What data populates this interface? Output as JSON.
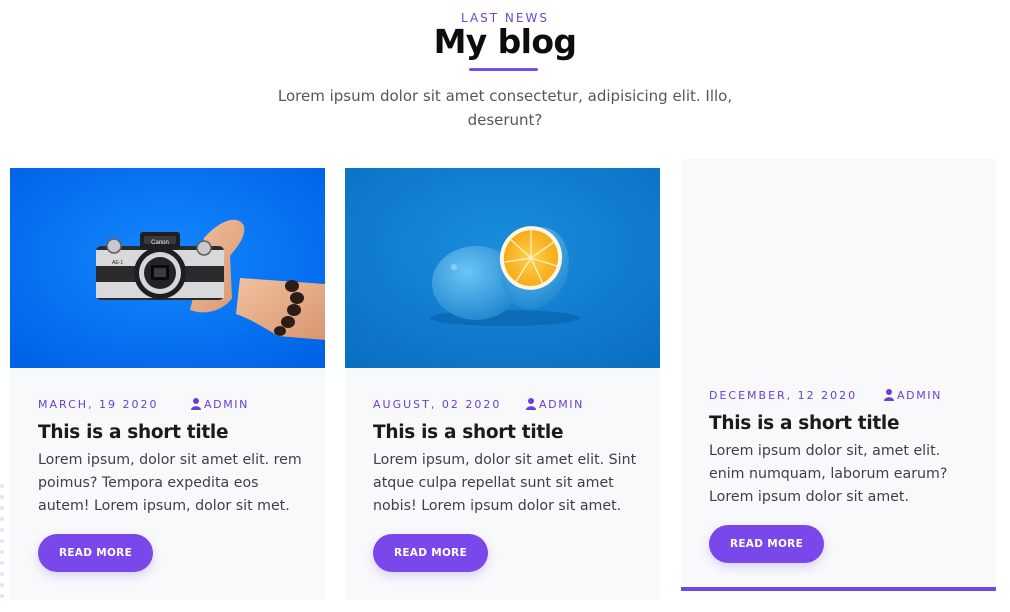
{
  "header": {
    "eyebrow": "LAST NEWS",
    "title": "My blog",
    "intro": "Lorem ipsum dolor sit amet consectetur, adipisicing elit. Illo, deserunt?"
  },
  "cards": [
    {
      "date": "MARCH, 19 2020",
      "author": "ADMIN",
      "title": "This is a short title",
      "text": "Lorem ipsum, dolor sit amet elit. rem poimus? Tempora expedita eos autem! Lorem ipsum, dolor sit met.",
      "button": "READ MORE",
      "image": "camera-in-hand-photo"
    },
    {
      "date": "AUGUST, 02 2020",
      "author": "ADMIN",
      "title": "This is a short title",
      "text": "Lorem ipsum, dolor sit amet elit. Sint atque culpa repellat sunt sit amet nobis! Lorem ipsum dolor sit amet.",
      "button": "READ MORE",
      "image": "blue-orange-photo"
    },
    {
      "date": "DECEMBER, 12 2020",
      "author": "ADMIN",
      "title": "This is a short title",
      "text": "Lorem ipsum dolor sit, amet elit. enim numquam, laborum earum? Lorem ipsum dolor sit amet.",
      "button": "READ MORE"
    }
  ],
  "icons": {
    "author": "user-icon"
  },
  "colors": {
    "accent": "#7a48ea",
    "meta_text": "#6b3ed8",
    "card_background": "#f8f9fb",
    "photo_background": "#0070f0"
  }
}
